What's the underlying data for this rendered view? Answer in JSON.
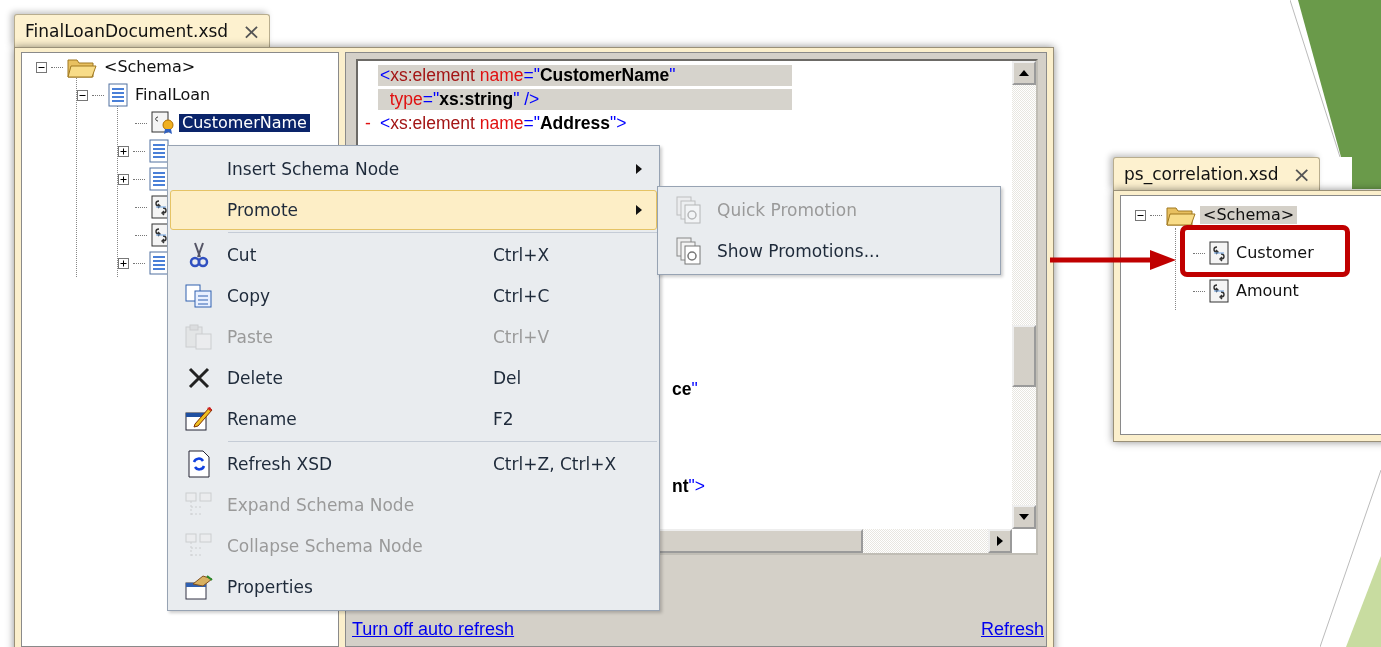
{
  "main_window": {
    "tab": {
      "title": "FinalLoanDocument.xsd",
      "close": "×"
    },
    "active": true,
    "tree": [
      {
        "label": "<Schema>",
        "kind": "folder",
        "expanded": true,
        "selected": false,
        "children": [
          {
            "label": "FinalLoan",
            "kind": "record",
            "expanded": true,
            "selected": false,
            "children": [
              {
                "label": "CustomerName",
                "kind": "promoted-field",
                "selected": true
              },
              {
                "kind": "record",
                "expanded": false
              },
              {
                "kind": "record",
                "expanded": false
              },
              {
                "kind": "field"
              },
              {
                "kind": "field"
              },
              {
                "kind": "record",
                "expanded": false
              }
            ]
          }
        ]
      }
    ],
    "code_lines": [
      {
        "kind": "full",
        "highlighted": true,
        "segments": [
          {
            "text": "<",
            "kind": "punct"
          },
          {
            "text": "xs:element",
            "kind": "tag"
          },
          {
            "text": " name",
            "kind": "attr"
          },
          {
            "text": "=\"",
            "kind": "punct"
          },
          {
            "text": "CustomerName",
            "kind": "value"
          },
          {
            "text": "\"",
            "kind": "punct"
          }
        ]
      },
      {
        "kind": "full",
        "highlighted": true,
        "segments": [
          {
            "text": "  type",
            "kind": "attr"
          },
          {
            "text": "=\"",
            "kind": "punct"
          },
          {
            "text": "xs:string",
            "kind": "value"
          },
          {
            "text": "\" />",
            "kind": "punct"
          }
        ]
      },
      {
        "kind": "full",
        "highlighted": false,
        "fold": "-",
        "segments": [
          {
            "text": "<",
            "kind": "punct"
          },
          {
            "text": "xs:element",
            "kind": "tag"
          },
          {
            "text": " name",
            "kind": "attr"
          },
          {
            "text": "=\"",
            "kind": "punct"
          },
          {
            "text": "Address",
            "kind": "value"
          },
          {
            "text": "\">",
            "kind": "punct"
          }
        ]
      },
      {
        "kind": "covered"
      },
      {
        "kind": "covered"
      },
      {
        "kind": "covered"
      },
      {
        "kind": "covered"
      },
      {
        "kind": "covered"
      },
      {
        "kind": "covered"
      },
      {
        "kind": "covered"
      },
      {
        "kind": "covered"
      },
      {
        "kind": "covered"
      },
      {
        "kind": "covered"
      },
      {
        "kind": "tail",
        "highlighted": false,
        "segments": [
          {
            "text": "ce",
            "kind": "value"
          },
          {
            "text": "\"",
            "kind": "punct"
          }
        ]
      },
      {
        "kind": "covered"
      },
      {
        "kind": "covered"
      },
      {
        "kind": "covered"
      },
      {
        "kind": "tail",
        "highlighted": false,
        "segments": [
          {
            "text": "nt",
            "kind": "value"
          },
          {
            "text": "\">",
            "kind": "punct"
          }
        ]
      }
    ],
    "links": [
      "Turn off auto refresh",
      "Refresh"
    ]
  },
  "context_menu": {
    "items": [
      {
        "label": "Insert Schema Node",
        "submenu": true,
        "selected": false,
        "disabled": false
      },
      {
        "label": "Promote",
        "submenu": true,
        "selected": true,
        "disabled": false,
        "separator_after": true
      },
      {
        "label": "Cut",
        "kind": "scissors",
        "shortcut": "Ctrl+X",
        "selected": false,
        "disabled": false
      },
      {
        "label": "Copy",
        "kind": "copy",
        "shortcut": "Ctrl+C",
        "selected": false,
        "disabled": false
      },
      {
        "label": "Paste",
        "kind": "paste",
        "shortcut": "Ctrl+V",
        "selected": false,
        "disabled": true
      },
      {
        "label": "Delete",
        "kind": "delete",
        "shortcut": "Del",
        "selected": false,
        "disabled": false
      },
      {
        "label": "Rename",
        "kind": "rename",
        "shortcut": "F2",
        "selected": false,
        "disabled": false,
        "separator_after": true
      },
      {
        "label": "Refresh XSD",
        "kind": "refresh",
        "shortcut": "Ctrl+Z, Ctrl+X",
        "selected": false,
        "disabled": false
      },
      {
        "label": "Expand Schema Node",
        "kind": "expand",
        "selected": false,
        "disabled": true
      },
      {
        "label": "Collapse Schema Node",
        "kind": "collapse",
        "selected": false,
        "disabled": true
      },
      {
        "label": "Properties",
        "kind": "properties",
        "selected": false,
        "disabled": false
      }
    ]
  },
  "submenu": {
    "items": [
      {
        "label": "Quick Promotion",
        "kind": "promotion",
        "selected": false,
        "disabled": true
      },
      {
        "label": "Show Promotions...",
        "kind": "promotion",
        "selected": false,
        "disabled": false
      }
    ]
  },
  "second_window": {
    "tab": {
      "title": "ps_correlation.xsd",
      "close": "×"
    },
    "active": false,
    "tree": [
      {
        "label": "<Schema>",
        "kind": "folder",
        "expanded": true,
        "selected": true,
        "children": [
          {
            "label": "Customer",
            "kind": "field",
            "selected": false
          },
          {
            "label": "Amount",
            "kind": "field",
            "selected": false
          }
        ]
      }
    ]
  }
}
